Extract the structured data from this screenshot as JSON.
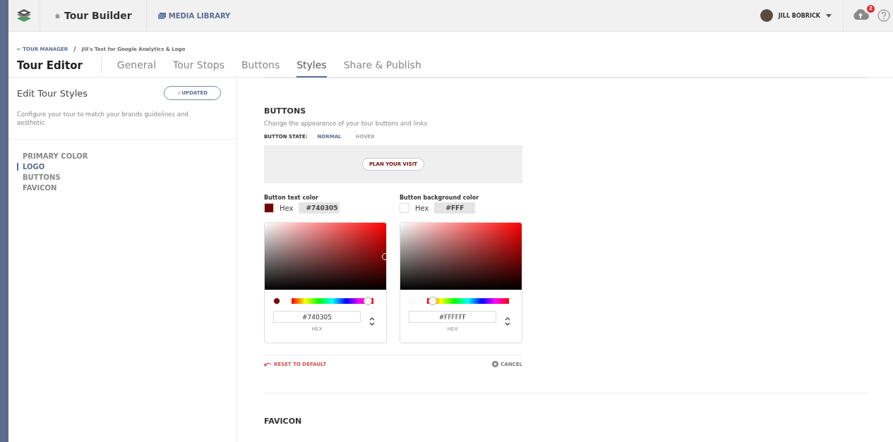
{
  "topbar": {
    "app_title": "Tour Builder",
    "media_link": "MEDIA LIBRARY",
    "user": "JILL BOBRICK",
    "notifications": "2"
  },
  "breadcrumb": {
    "back": "← TOUR MANAGER",
    "separator": "/",
    "current": "Jill's Test for Google Analytics & Logo"
  },
  "page_title": "Tour Editor",
  "tabs": [
    {
      "label": "General",
      "selected": false
    },
    {
      "label": "Tour Stops",
      "selected": false
    },
    {
      "label": "Buttons",
      "selected": false
    },
    {
      "label": "Styles",
      "selected": true
    },
    {
      "label": "Share & Publish",
      "selected": false
    }
  ],
  "sidebar": {
    "title": "Edit Tour Styles",
    "badge": "✓UPDATED",
    "description": "Configure your tour to match your brands guidelines and aesthetic",
    "items": [
      {
        "label": "PRIMARY COLOR",
        "selected": false
      },
      {
        "label": "LOGO",
        "selected": true
      },
      {
        "label": "BUTTONS",
        "selected": false
      },
      {
        "label": "FAVICON",
        "selected": false
      }
    ]
  },
  "section": {
    "title": "BUTTONS",
    "description": "Change the appearance of your tour buttons and links",
    "state_label": "BUTTON STATE:",
    "states": [
      {
        "label": "NORMAL",
        "selected": true
      },
      {
        "label": "HOVER",
        "selected": false
      }
    ],
    "preview_button": "PLAN YOUR VISIT",
    "pickers": [
      {
        "label": "Button text color",
        "color": "#740305",
        "hex_label": "Hex",
        "hex_short": "#740305",
        "hue": {
          "level": 0.98
        },
        "value": "#740305",
        "format": "HEX"
      },
      {
        "label": "Button background color",
        "color": "#ffffff",
        "hex_label": "Hex",
        "hex_short": "#FFF",
        "hue": {
          "level": 0.02
        },
        "value": "#FFFFFF",
        "format": "HEX"
      }
    ],
    "reset": "RESET TO DEFAULT",
    "cancel": "CANCEL"
  },
  "next_section": "FAVICON"
}
